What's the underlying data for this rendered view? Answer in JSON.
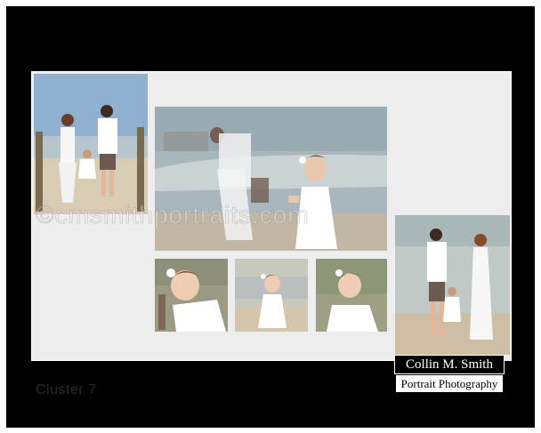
{
  "watermark": {
    "text": "©cmsmithportraits.com"
  },
  "cluster": {
    "label": "Cluster 7"
  },
  "logo": {
    "line1": "Collin M. Smith",
    "line2": "Portrait Photography"
  },
  "photos": [
    {
      "name": "photo-family-boardwalk",
      "subject": "family-walking"
    },
    {
      "name": "photo-toddler-beach-main",
      "subject": "toddler-with-couple"
    },
    {
      "name": "photo-toddler-closeup-1",
      "subject": "toddler-closeup"
    },
    {
      "name": "photo-toddler-closeup-2",
      "subject": "toddler-standing"
    },
    {
      "name": "photo-toddler-closeup-3",
      "subject": "toddler-closeup"
    },
    {
      "name": "photo-family-walking-beach",
      "subject": "family-walking"
    }
  ],
  "colors": {
    "frame": "#000000",
    "board": "#ededed",
    "sky": "#9fb7cc",
    "sand": "#cbbfa8",
    "sea": "#b8c4c6"
  }
}
